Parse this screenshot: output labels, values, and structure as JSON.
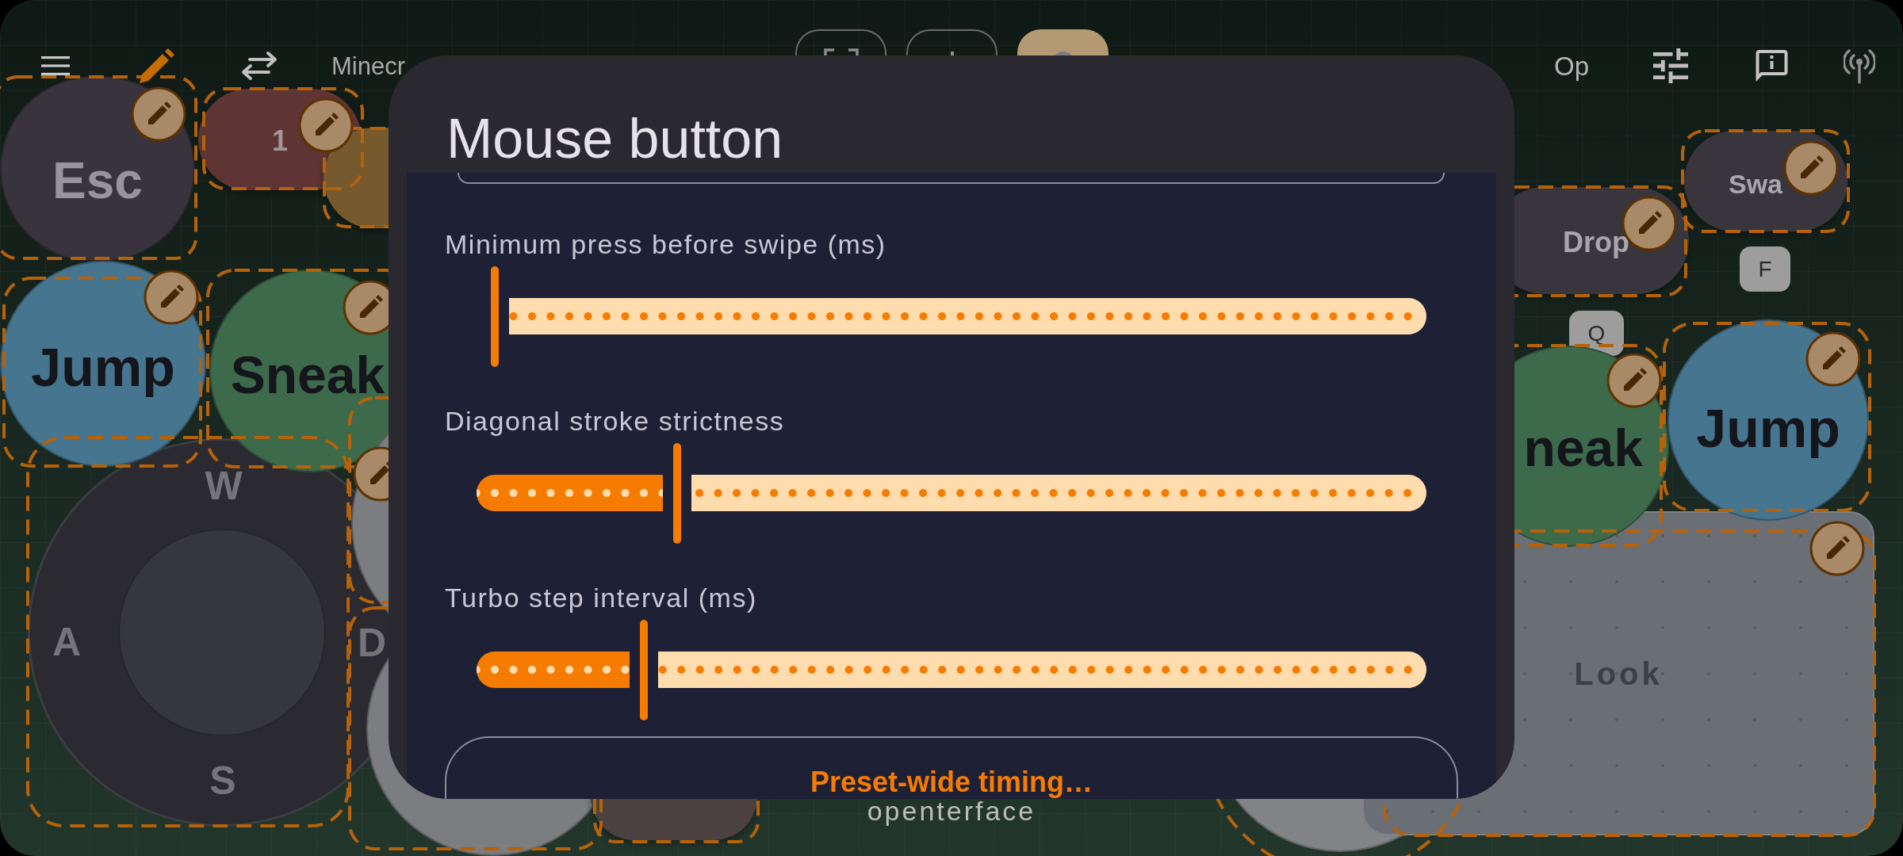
{
  "top_bar": {
    "title": "Minecr",
    "toolbar_buttons": [
      {
        "selected": false
      },
      {
        "selected": false
      },
      {
        "selected": true
      }
    ],
    "profile_label": "Op"
  },
  "canvas": {
    "edit_mode": true,
    "controls": [
      {
        "kind": "circle",
        "label": "Esc",
        "color": "#38333d"
      },
      {
        "kind": "pill",
        "label": "1",
        "color": "#5e3434"
      },
      {
        "kind": "pill",
        "color": "#765a2e"
      },
      {
        "kind": "circle",
        "label": "Jump",
        "color": "#467590"
      },
      {
        "kind": "circle",
        "label": "Sneak",
        "color": "#3c6a4b"
      },
      {
        "kind": "circle",
        "color": "#7c7d80"
      },
      {
        "kind": "joystick",
        "keys": [
          "W",
          "A",
          "S",
          "D"
        ]
      },
      {
        "kind": "circle",
        "color": "#7c7d80"
      },
      {
        "kind": "pill",
        "color": "#4a4140"
      },
      {
        "kind": "pill",
        "label": "Drop",
        "key": "Q",
        "color": "#38353d"
      },
      {
        "kind": "pill",
        "label": "Swa",
        "key": "F",
        "color": "#38353d"
      },
      {
        "kind": "circle",
        "label": "neak",
        "color": "#3c6a4b"
      },
      {
        "kind": "circle",
        "label": "Jump",
        "color": "#467590"
      },
      {
        "kind": "pad",
        "label": "Look",
        "color": "#6a6e75"
      },
      {
        "kind": "circle",
        "color": "#828386"
      }
    ],
    "logo": "openterface"
  },
  "dialog": {
    "title": "Mouse button",
    "sliders": [
      {
        "label": "Minimum press before swipe (ms)",
        "level": 0
      },
      {
        "label": "Diagonal stroke strictness",
        "level": 0.2
      },
      {
        "label": "Turbo step interval (ms)",
        "level": 0.163
      }
    ],
    "button": "Preset-wide timing…"
  }
}
